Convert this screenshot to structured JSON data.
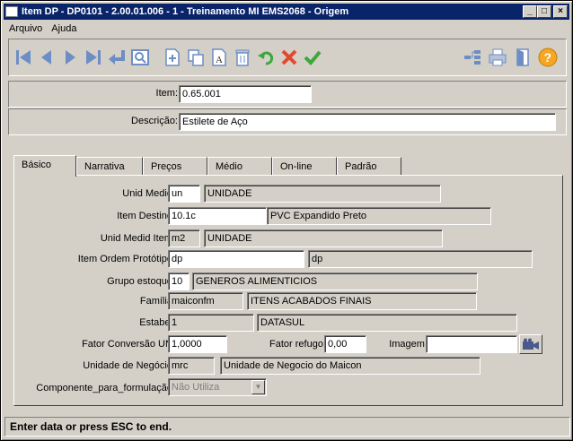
{
  "window": {
    "title": "Item DP - DP0101 - 2.00.01.006 - 1 - Treinamento MI    EMS2068 - Origem",
    "minimize": "_",
    "maximize": "□",
    "close": "×"
  },
  "menu": [
    "Arquivo",
    "Ajuda"
  ],
  "toolbar": {
    "left": [
      "first-icon",
      "previous-icon",
      "next-icon",
      "last-icon",
      "goto-icon",
      "search-icon",
      "new-icon",
      "copy-icon",
      "edit-icon",
      "delete-icon",
      "undo-icon",
      "cancel-icon",
      "confirm-icon"
    ],
    "right": [
      "navigate-icon",
      "print-icon",
      "exit-icon",
      "help-icon"
    ]
  },
  "header": {
    "item_label": "Item:",
    "item_value": "0.65.001",
    "descricao_label": "Descrição:",
    "descricao_value": "Estilete de Aço"
  },
  "tabs": [
    "Básico",
    "Narrativa",
    "Preços",
    "Médio",
    "On-line",
    "Padrão"
  ],
  "basico": {
    "unid_medid_label": "Unid Medid:",
    "unid_medid_code": "un",
    "unid_medid_desc": "UNIDADE",
    "item_destino_label": "Item Destino:",
    "item_destino_code": "10.1c",
    "item_destino_desc": "PVC Expandido Preto",
    "unid_medid_item_label": "Unid Medid Item:",
    "unid_medid_item_code": "m2",
    "unid_medid_item_desc": "UNIDADE",
    "item_ordem_label": "Item Ordem Protótipo:",
    "item_ordem_code": "dp",
    "item_ordem_desc": "dp",
    "grupo_estoque_label": "Grupo estoque:",
    "grupo_estoque_code": "10",
    "grupo_estoque_desc": "GENEROS ALIMENTICIOS",
    "familia_label": "Família:",
    "familia_code": "maiconfm",
    "familia_desc": "ITENS ACABADOS FINAIS",
    "estabel_label": "Estabel:",
    "estabel_code": "1",
    "estabel_desc": "DATASUL",
    "fator_conversao_label": "Fator Conversão UN:",
    "fator_conversao_value": "1,0000",
    "fator_refugo_label": "Fator refugo:",
    "fator_refugo_value": "0,00",
    "imagem_label": "Imagem:",
    "imagem_value": "",
    "unidade_negocio_label": "Unidade de Negócio:",
    "unidade_negocio_code": "mrc",
    "unidade_negocio_desc": "Unidade de Negocio do Maicon",
    "componente_label": "Componente_para_formulação:",
    "componente_value": "Não Utiliza"
  },
  "status": "Enter data or press ESC to end."
}
